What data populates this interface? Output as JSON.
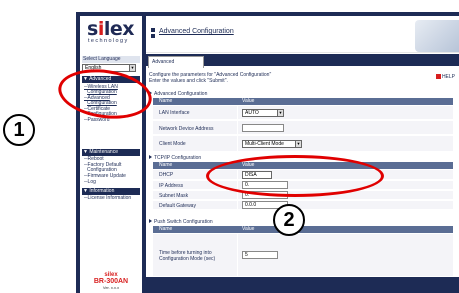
{
  "annotations": {
    "circle_1": "1",
    "circle_2": "2"
  },
  "sidebar": {
    "logo_text_a": "s",
    "logo_text_i": "i",
    "logo_text_rest": "lex",
    "logo_tagline": "technology",
    "language_heading": "Select Language",
    "language_value": "English",
    "menu_items_top": [
      "Advanced Configuration",
      "Wireless LAN",
      "Configuration",
      "Advanced",
      "Configuration",
      "Certificate",
      "Configuration",
      "Password"
    ],
    "maintenance_heading": "Maintenance",
    "maintenance_items": [
      "Reboot",
      "Factory Default",
      "Configuration",
      "Firmware Update",
      "Log"
    ],
    "information_heading": "Information",
    "information_items": [
      "License Information"
    ],
    "brand": "silex",
    "model": "BR-300AN",
    "version": "Ver. x.x.x"
  },
  "header": {
    "title": "Advanced Configuration",
    "tab_label": "Advanced Configuration"
  },
  "main": {
    "instructions_line1": "Configure the parameters for \"Advanced Configuration\"",
    "instructions_line2": "Enter the values and click \"Submit\".",
    "help_label": "HELP",
    "advanced_section": {
      "title": "Advanced Configuration",
      "col_name": "Name",
      "col_value": "Value",
      "rows": [
        {
          "name": "LAN Interface",
          "value": "AUTO"
        },
        {
          "name": "Network Device Address",
          "value": ""
        },
        {
          "name": "Client Mode",
          "value": "Multi-Client Mode"
        }
      ]
    },
    "tcpip_section": {
      "title": "TCP/IP Configuration",
      "col_name": "Name",
      "col_value": "Value",
      "rows": [
        {
          "name": "DHCP",
          "value": "DISA"
        },
        {
          "name": "IP Address",
          "value": "0."
        },
        {
          "name": "Subnet Mask",
          "value": "0."
        },
        {
          "name": "Default Gateway",
          "value": "0.0.0"
        }
      ]
    },
    "push_section": {
      "title": "Push Switch Configuration",
      "col_name": "Name",
      "col_value": "Value",
      "rows": [
        {
          "name_line1": "Time before turning into",
          "name_line2": "Configuration Mode (sec)",
          "value": "5"
        }
      ]
    }
  },
  "colors": {
    "navy": "#1d2b55",
    "accent_red": "#d81e1e",
    "header_gray": "#5a6d94",
    "ellipse_red": "#e00000"
  },
  "icons": [
    "question-circle-icon",
    "triangle-bullet-icon",
    "chevron-down-icon"
  ]
}
